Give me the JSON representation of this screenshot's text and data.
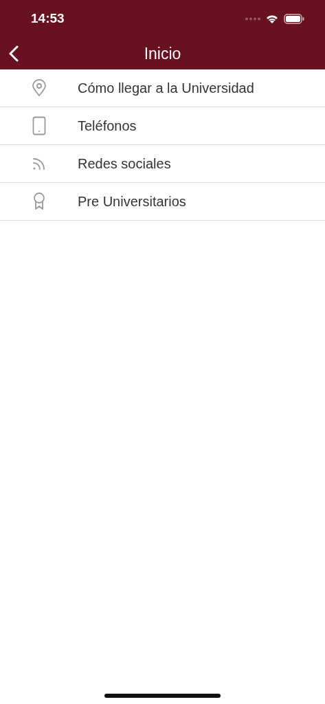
{
  "status_bar": {
    "time": "14:53"
  },
  "nav_bar": {
    "title": "Inicio"
  },
  "menu": [
    {
      "kind": "pin",
      "label": "Cómo llegar a la Universidad"
    },
    {
      "kind": "phone",
      "label": "Teléfonos"
    },
    {
      "kind": "feed",
      "label": "Redes sociales"
    },
    {
      "kind": "award",
      "label": "Pre Universitarios"
    }
  ]
}
